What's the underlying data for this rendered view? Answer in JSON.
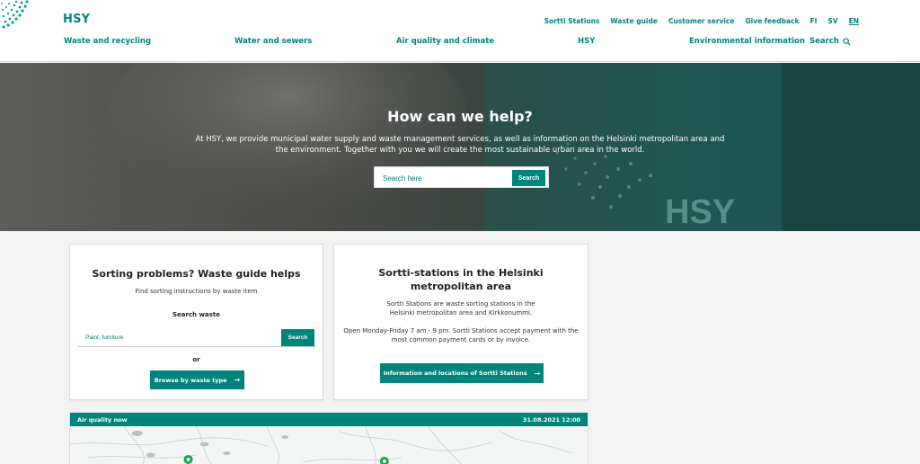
{
  "header": {
    "brand": "HSY",
    "utility_nav": [
      "Sortti Stations",
      "Waste guide",
      "Customer service",
      "Give feedback",
      "FI",
      "SV",
      "EN"
    ],
    "main_nav": [
      "Waste and recycling",
      "Water and sewers",
      "Air quality and climate",
      "HSY",
      "Environmental information"
    ],
    "search_label": "Search"
  },
  "hero": {
    "title": "How can we help?",
    "text": "At HSY, we provide municipal water supply and waste management services, as well as information on the Helsinki metropolitan area and the environment. Together with you we will create the most sustainable urban area in the world.",
    "search_placeholder": "Search here",
    "search_button": "Search",
    "bg_logo_text": "HSY"
  },
  "waste_card": {
    "title": "Sorting problems? Waste guide helps",
    "subtitle": "Find sorting instructions by waste item",
    "search_label": "Search waste",
    "search_placeholder": "Paint, furniture",
    "search_button": "Search",
    "or": "or",
    "browse_button": "Browse by waste type"
  },
  "sortti_card": {
    "title": "Sortti-stations in the Helsinki metropolitan area",
    "desc1": "Sortti Stations are waste sorting stations in the Helsinki metropolitan area and Kirkkonummi.",
    "desc2": "Open  Monday-Friday  7 am - 9 pm. Sortti Stations accept payment with the most common payment cards or by invoice.",
    "button": "Information and locations of Sortti Stations"
  },
  "air_quality": {
    "title": "Air quality now",
    "datetime": "31.08.2021 12:00"
  },
  "colors": {
    "brand": "#00857c",
    "page_bg": "#f3f3f3",
    "marker": "#1aa04a"
  },
  "icons": [
    "search-icon",
    "arrow-right-icon",
    "logo-dots-icon",
    "map-marker-icon"
  ]
}
